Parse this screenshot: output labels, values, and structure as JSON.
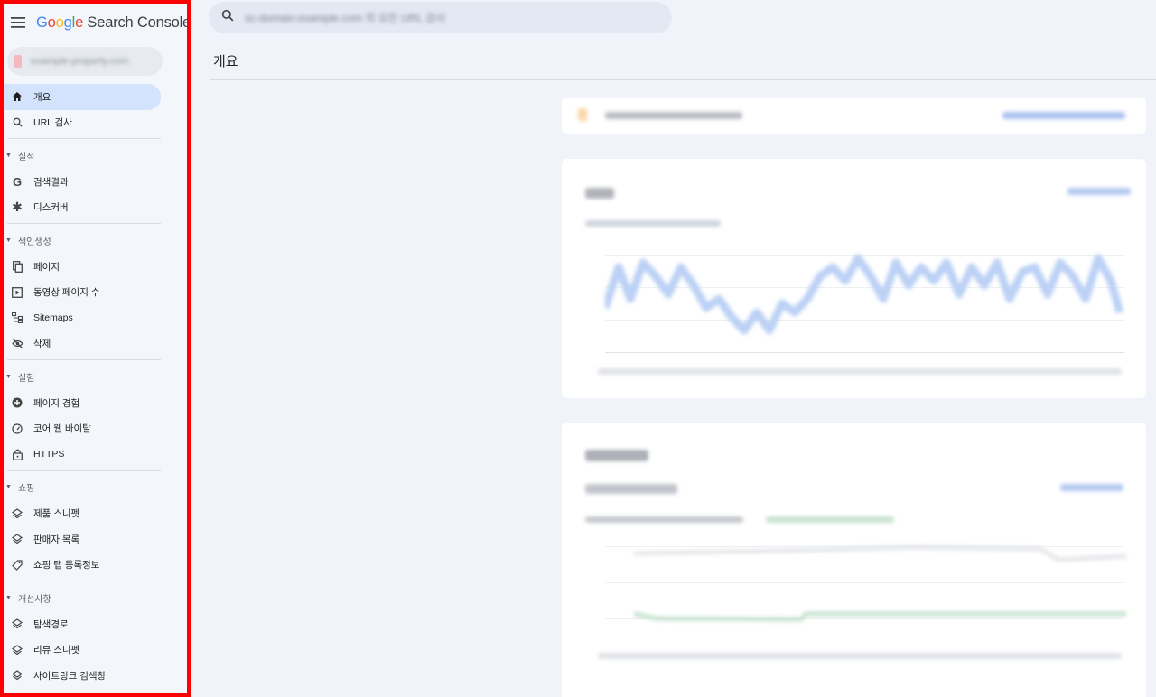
{
  "app": {
    "brand": {
      "g1": "G",
      "o1": "o",
      "o2": "o",
      "g2": "g",
      "l": "l",
      "e": "e",
      "rest": " Search Console"
    },
    "menu_icon": "hamburger-menu-icon"
  },
  "property": {
    "label": "example-property.com"
  },
  "search": {
    "placeholder": "sc-domain:example.com 의 모든 URL 검사",
    "icon": "search-icon"
  },
  "header": {
    "title": "개요"
  },
  "nav": {
    "top": [
      {
        "label": "개요",
        "icon": "home-icon",
        "active": true
      },
      {
        "label": "URL 검사",
        "icon": "search-icon",
        "active": false
      }
    ],
    "sections": [
      {
        "title": "실적",
        "items": [
          {
            "label": "검색결과",
            "icon": "google-g-icon"
          },
          {
            "label": "디스커버",
            "icon": "asterisk-icon"
          }
        ]
      },
      {
        "title": "색인생성",
        "items": [
          {
            "label": "페이지",
            "icon": "pages-icon"
          },
          {
            "label": "동영상 페이지 수",
            "icon": "video-page-icon"
          },
          {
            "label": "Sitemaps",
            "icon": "sitemap-icon"
          },
          {
            "label": "삭제",
            "icon": "eye-off-icon"
          }
        ]
      },
      {
        "title": "실험",
        "items": [
          {
            "label": "페이지 경험",
            "icon": "plus-circle-icon"
          },
          {
            "label": "코어 웹 바이탈",
            "icon": "gauge-icon"
          },
          {
            "label": "HTTPS",
            "icon": "lock-icon"
          }
        ]
      },
      {
        "title": "쇼핑",
        "items": [
          {
            "label": "제품 스니펫",
            "icon": "layers-icon"
          },
          {
            "label": "판매자 목록",
            "icon": "layers-icon"
          },
          {
            "label": "쇼핑 탭 등록정보",
            "icon": "tag-icon"
          }
        ]
      },
      {
        "title": "개선사항",
        "items": [
          {
            "label": "탐색경로",
            "icon": "layers-icon"
          },
          {
            "label": "리뷰 스니펫",
            "icon": "layers-icon"
          },
          {
            "label": "사이트링크 검색창",
            "icon": "layers-icon"
          }
        ]
      }
    ]
  },
  "colors": {
    "accent": "#1a73e8",
    "active_bg": "#d3e3fd",
    "highlight_border": "#ff0000",
    "chart_line": "#b8cef5",
    "chart_green": "#a8d5b5"
  }
}
